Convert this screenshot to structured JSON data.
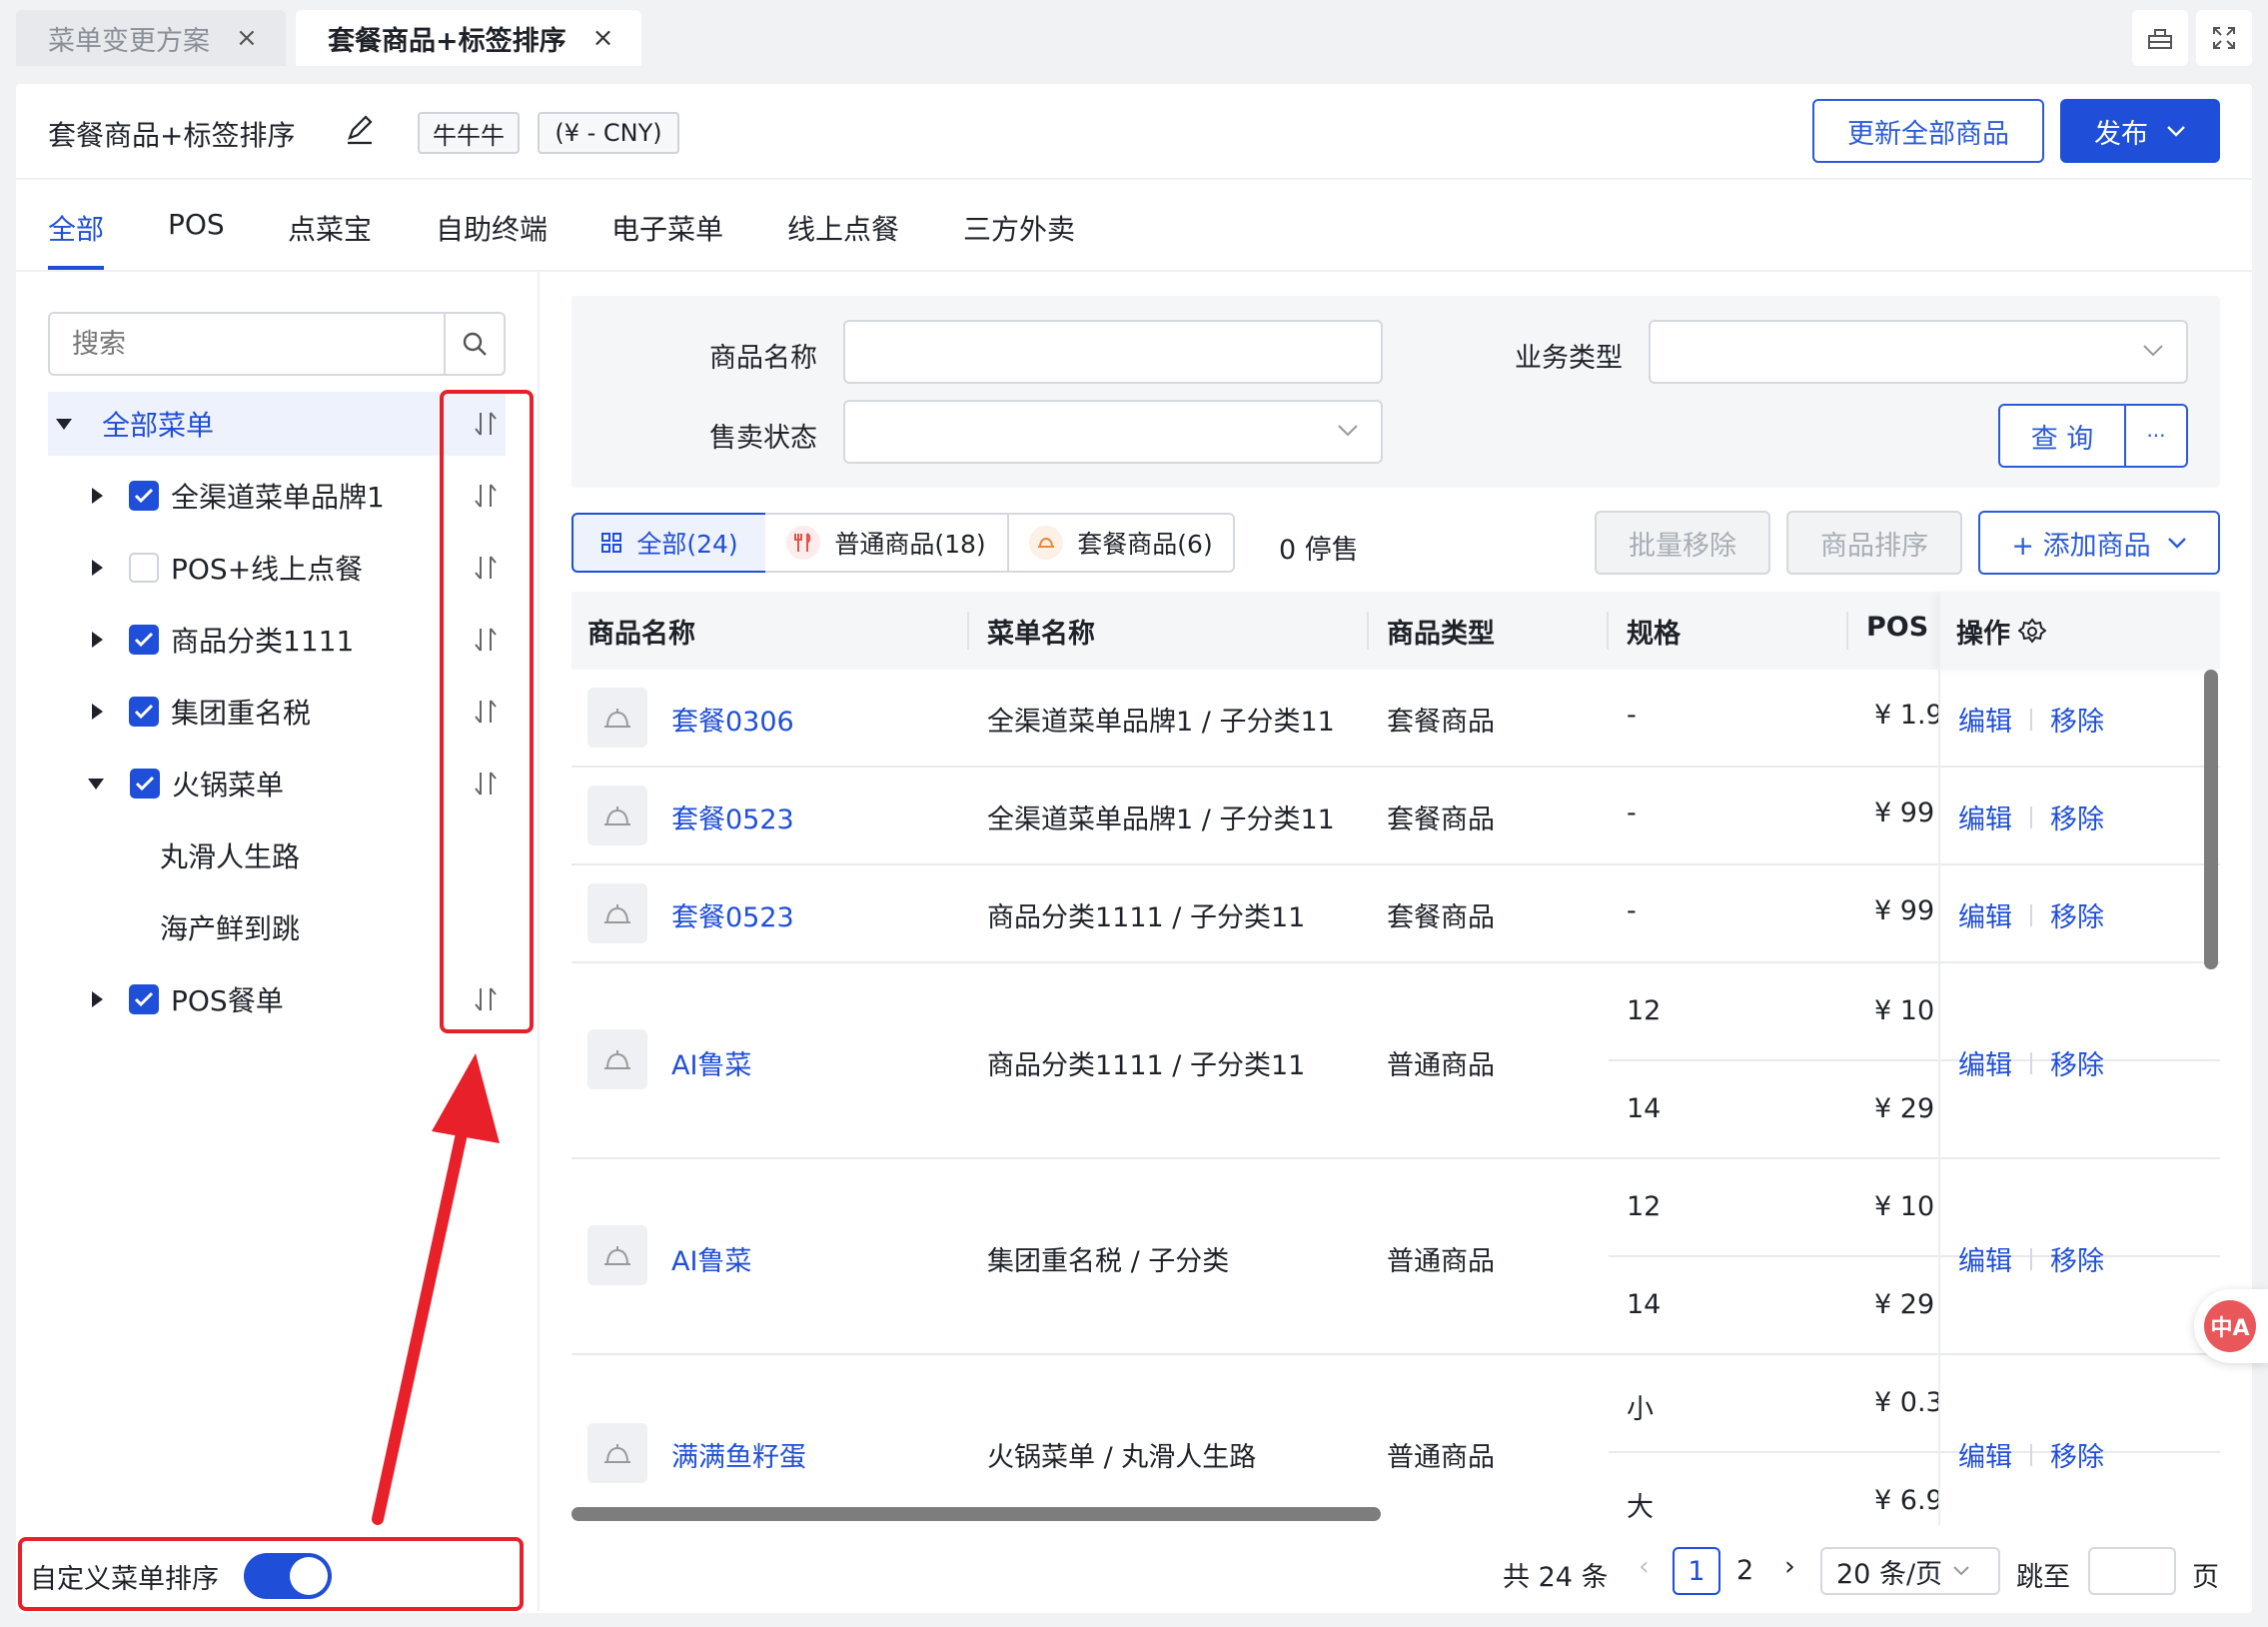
{
  "window_tabs": [
    {
      "label": "菜单变更方案",
      "close": "×",
      "active": false
    },
    {
      "label": "套餐商品+标签排序",
      "close": "×",
      "active": true
    }
  ],
  "window_controls": [
    "share-icon",
    "fullscreen-icon"
  ],
  "header": {
    "title": "套餐商品+标签排序",
    "brand_tag": "牛牛牛",
    "currency_tag": "(¥ - CNY)",
    "update_all_label": "更新全部商品",
    "publish_label": "发布"
  },
  "nav_tabs": [
    "全部",
    "POS",
    "点菜宝",
    "自助终端",
    "电子菜单",
    "线上点餐",
    "三方外卖"
  ],
  "sidebar": {
    "search_placeholder": "搜索",
    "tree": [
      {
        "label": "全部菜单",
        "expand": "down",
        "checkbox": null,
        "sort": true,
        "selected": true
      },
      {
        "label": "全渠道菜单品牌1",
        "expand": "right",
        "checkbox": "on",
        "sort": true
      },
      {
        "label": "POS+线上点餐",
        "expand": "right",
        "checkbox": "off",
        "sort": true
      },
      {
        "label": "商品分类1111",
        "expand": "right",
        "checkbox": "on",
        "sort": true
      },
      {
        "label": "集团重名税",
        "expand": "right",
        "checkbox": "on",
        "sort": true
      },
      {
        "label": "火锅菜单",
        "expand": "down",
        "checkbox": "on",
        "sort": true
      },
      {
        "label": "丸滑人生路",
        "expand": null,
        "checkbox": null,
        "sort": false
      },
      {
        "label": "海产鲜到跳",
        "expand": null,
        "checkbox": null,
        "sort": false
      },
      {
        "label": "POS餐单",
        "expand": "right",
        "checkbox": "on",
        "sort": true
      }
    ],
    "custom_sort_label": "自定义菜单排序",
    "custom_sort_on": true
  },
  "filter": {
    "name_label": "商品名称",
    "name_value": "",
    "biz_label": "业务类型",
    "biz_value": "",
    "status_label": "售卖状态",
    "status_value": "",
    "query_label": "查 询",
    "more_label": "···"
  },
  "segments": [
    {
      "label": "全部(24)",
      "icon": "grid-icon",
      "active": true
    },
    {
      "label": "普通商品(18)",
      "icon": "fork-knife-icon",
      "active": false
    },
    {
      "label": "套餐商品(6)",
      "icon": "combo-icon",
      "active": false
    }
  ],
  "stopped_label": "0 停售",
  "actions": {
    "batch_remove": "批量移除",
    "sort": "商品排序",
    "add": "+ 添加商品"
  },
  "table": {
    "headers": [
      "商品名称",
      "菜单名称",
      "商品类型",
      "规格",
      "POS",
      "操作"
    ],
    "rows": [
      {
        "name": "套餐0306",
        "menu": "全渠道菜单品牌1 / 子分类11",
        "type": "套餐商品",
        "specs": [
          {
            "spec": "-",
            "pos": "¥ 1.9"
          }
        ]
      },
      {
        "name": "套餐0523",
        "menu": "全渠道菜单品牌1 / 子分类11",
        "type": "套餐商品",
        "specs": [
          {
            "spec": "-",
            "pos": "¥ 99"
          }
        ]
      },
      {
        "name": "套餐0523",
        "menu": "商品分类1111 / 子分类11",
        "type": "套餐商品",
        "specs": [
          {
            "spec": "-",
            "pos": "¥ 99"
          }
        ]
      },
      {
        "name": "AI鲁菜",
        "menu": "商品分类1111 / 子分类11",
        "type": "普通商品",
        "specs": [
          {
            "spec": "12",
            "pos": "¥ 10"
          },
          {
            "spec": "14",
            "pos": "¥ 29"
          }
        ]
      },
      {
        "name": "AI鲁菜",
        "menu": "集团重名税 / 子分类",
        "type": "普通商品",
        "specs": [
          {
            "spec": "12",
            "pos": "¥ 10"
          },
          {
            "spec": "14",
            "pos": "¥ 29"
          }
        ]
      },
      {
        "name": "满满鱼籽蛋",
        "menu": "火锅菜单 / 丸滑人生路",
        "type": "普通商品",
        "specs": [
          {
            "spec": "小",
            "pos": "¥ 0.3"
          },
          {
            "spec": "大",
            "pos": "¥ 6.9"
          }
        ]
      }
    ],
    "edit_label": "编辑",
    "remove_label": "移除"
  },
  "pagination": {
    "total": "共 24 条",
    "pages": [
      "1",
      "2"
    ],
    "current": "1",
    "page_size": "20 条/页",
    "jump_label": "跳至",
    "page_unit": "页"
  },
  "floating": {
    "translate_label": "中A"
  },
  "colors": {
    "primary": "#1f4fd8",
    "highlight": "#e8202a",
    "checkbox": "#1f4fd8"
  }
}
